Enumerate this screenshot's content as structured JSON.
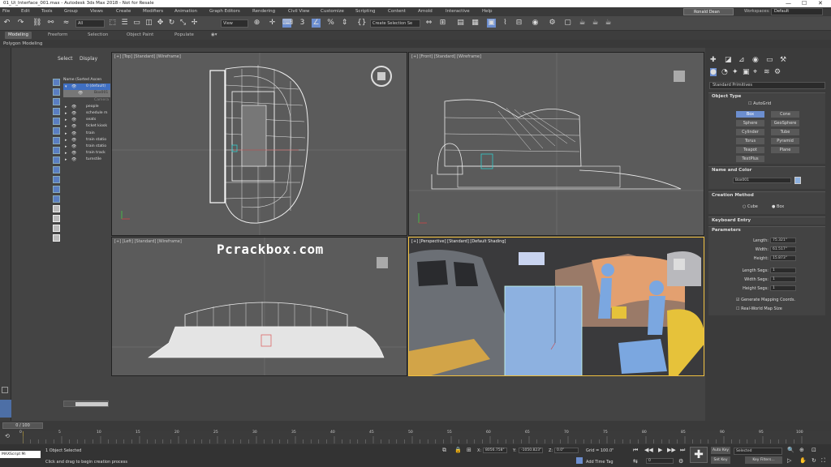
{
  "window": {
    "title": "01_Ui_Interface_001.max - Autodesk 3ds Max 2018 - Not for Resale"
  },
  "menu": [
    "File",
    "Edit",
    "Tools",
    "Group",
    "Views",
    "Create",
    "Modifiers",
    "Animation",
    "Graph Editors",
    "Rendering",
    "Civil View",
    "Customize",
    "Scripting",
    "Content",
    "Arnold",
    "Interactive",
    "Help"
  ],
  "user": {
    "name": "Ronald Dean"
  },
  "workspace": {
    "label": "Workspaces:",
    "value": "Default"
  },
  "toolbar": {
    "filter": "All",
    "view": "View",
    "selection_set": "Create Selection Se"
  },
  "ribbon": {
    "tabs": [
      "Modeling",
      "Freeform",
      "Selection",
      "Object Paint",
      "Populate"
    ],
    "sub": "Polygon Modeling"
  },
  "scene": {
    "tabs": {
      "select": "Select",
      "display": "Display"
    },
    "column_header": "Name (Sorted Ascen",
    "rows": [
      "0 (default)",
      "Box001",
      "Camera",
      "people",
      "schedule m",
      "seats",
      "ticket kiosk",
      "train",
      "train statio",
      "train statio",
      "train track",
      "turnstile"
    ]
  },
  "viewports": {
    "top": "[+] [Top] [Standard] [Wireframe]",
    "front": "[+] [Front] [Standard] [Wireframe]",
    "left": "[+] [Left] [Standard] [Wireframe]",
    "persp": "[+] [Perspective] [Standard] [Default Shading]"
  },
  "watermark": "Pcrackbox.com",
  "command_panel": {
    "dropdown": "Standard Primitives",
    "object_type": {
      "title": "Object Type",
      "autogrid": "AutoGrid",
      "buttons": [
        "Box",
        "Cone",
        "Sphere",
        "GeoSphere",
        "Cylinder",
        "Tube",
        "Torus",
        "Pyramid",
        "Teapot",
        "Plane",
        "TextPlus"
      ]
    },
    "name_color": {
      "title": "Name and Color",
      "name": "Box001"
    },
    "creation": {
      "title": "Creation Method",
      "cube": "Cube",
      "box": "Box"
    },
    "keyboard": {
      "title": "Keyboard Entry"
    },
    "params": {
      "title": "Parameters",
      "length_label": "Length:",
      "length": "75.321\"",
      "width_label": "Width:",
      "width": "61.517\"",
      "height_label": "Height:",
      "height": "15.873\"",
      "lsegs_label": "Length Segs:",
      "lsegs": "1",
      "wsegs_label": "Width Segs:",
      "wsegs": "1",
      "hsegs_label": "Height Segs:",
      "hsegs": "1",
      "gen_map": "Generate Mapping Coords.",
      "real_world": "Real-World Map Size"
    }
  },
  "timeline": {
    "frame": "0 / 100",
    "ticks": [
      "0",
      "5",
      "10",
      "15",
      "20",
      "25",
      "30",
      "35",
      "40",
      "45",
      "50",
      "55",
      "60",
      "65",
      "70",
      "75",
      "80",
      "85",
      "90",
      "95",
      "100"
    ]
  },
  "status": {
    "script": "MAXScript Mi",
    "selected": "1 Object Selected",
    "prompt": "Click and drag to begin creation process",
    "x": "8056.758\"",
    "y": "-1050.823\"",
    "z": "0.0\"",
    "grid": "Grid = 100.0\"",
    "addtime": "Add Time Tag",
    "autokey": "Auto Key",
    "setkey": "Set Key",
    "keymode": "Selected",
    "keyfilters": "Key Filters...",
    "frame_field": "0"
  }
}
